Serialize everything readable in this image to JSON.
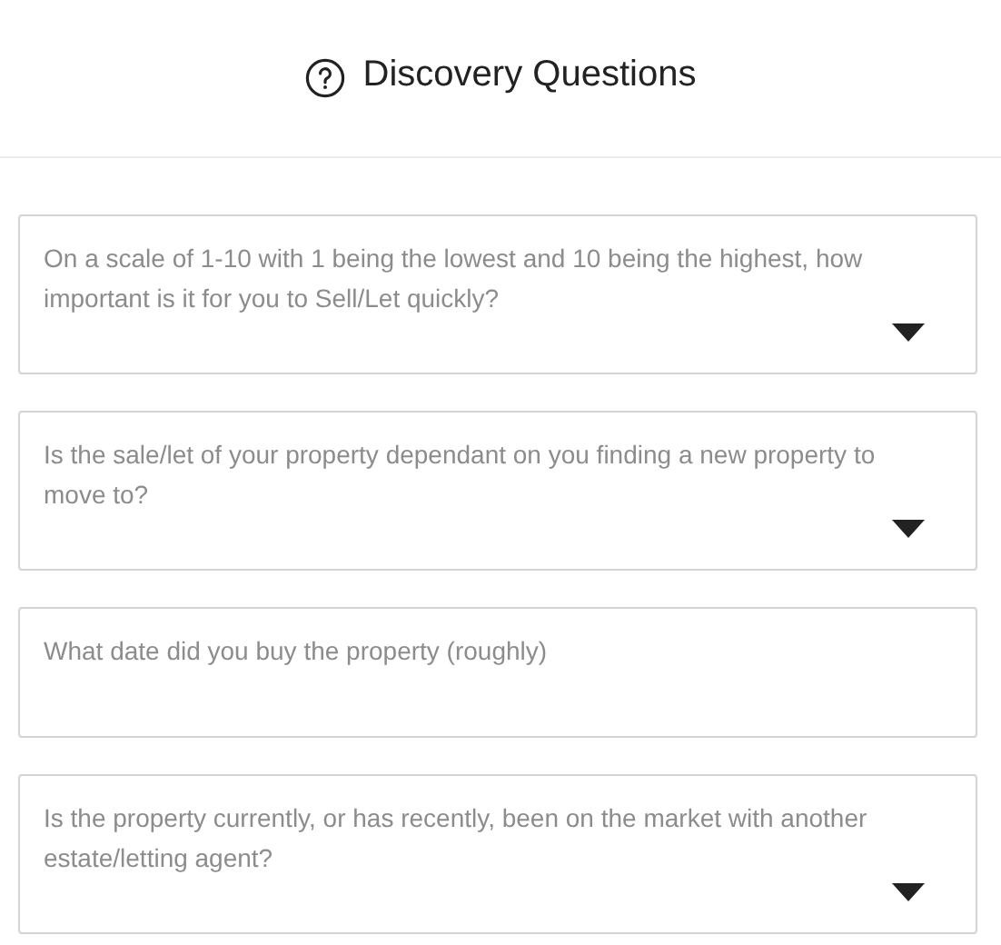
{
  "header": {
    "title": "Discovery Questions"
  },
  "questions": [
    {
      "kind": "select",
      "placeholder": "On a scale of 1-10 with 1 being the lowest and 10 being the highest, how important is it for you to Sell/Let quickly?"
    },
    {
      "kind": "select",
      "placeholder": "Is the sale/let of your property dependant on you finding a new property to move to?"
    },
    {
      "kind": "text",
      "placeholder": "What date did you buy the property (roughly)"
    },
    {
      "kind": "select",
      "placeholder": "Is the property currently, or has recently, been on the market with another estate/letting agent?"
    }
  ]
}
